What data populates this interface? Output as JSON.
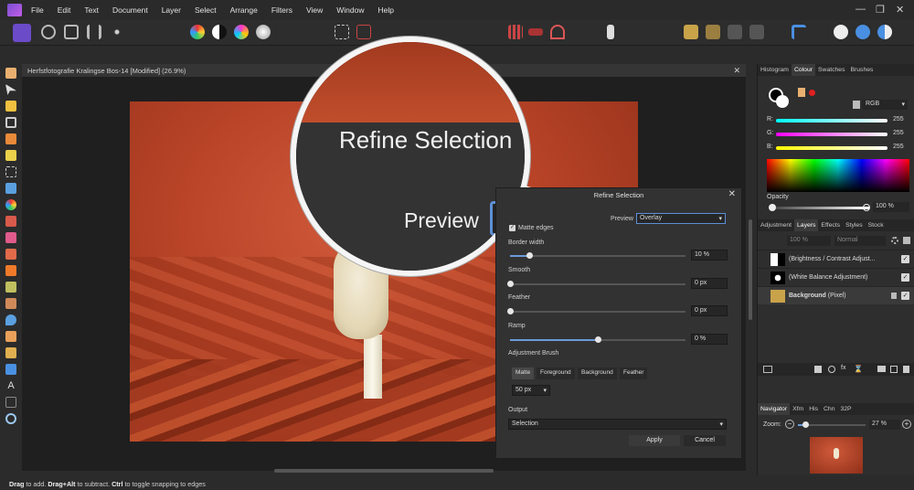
{
  "menubar": {
    "items": [
      "File",
      "Edit",
      "Text",
      "Document",
      "Layer",
      "Select",
      "Arrange",
      "Filters",
      "View",
      "Window",
      "Help"
    ]
  },
  "document": {
    "tab_title": "Herfstfotografie Kralingse Bos-14 [Modified] (26.9%)"
  },
  "magnifier": {
    "title": "Refine Selection",
    "preview_label": "Preview"
  },
  "dialog": {
    "title": "Refine Selection",
    "preview_label": "Preview",
    "preview_value": "Overlay",
    "matte_edges_label": "Matte edges",
    "matte_edges_checked": true,
    "sliders": [
      {
        "label": "Border width",
        "value": "10 %",
        "fraction": 0.11
      },
      {
        "label": "Smooth",
        "value": "0 px",
        "fraction": 0.0
      },
      {
        "label": "Feather",
        "value": "0 px",
        "fraction": 0.0
      },
      {
        "label": "Ramp",
        "value": "0 %",
        "fraction": 0.5
      }
    ],
    "adjustment_brush_label": "Adjustment Brush",
    "brush_modes": [
      "Matte",
      "Foreground",
      "Background",
      "Feather"
    ],
    "brush_mode_selected": "Matte",
    "brush_size": "50 px",
    "output_label": "Output",
    "output_value": "Selection",
    "apply_label": "Apply",
    "cancel_label": "Cancel"
  },
  "panels": {
    "top_tabs": [
      "Histogram",
      "Colour",
      "Swatches",
      "Brushes"
    ],
    "top_tab_active": "Colour",
    "colour_model": "RGB",
    "rgb": [
      {
        "label": "R:",
        "value": "255",
        "color": "#ff6b6b"
      },
      {
        "label": "G:",
        "value": "255",
        "color": "#8cff6b"
      },
      {
        "label": "B:",
        "value": "255",
        "color": "#6b8cff"
      }
    ],
    "opacity_label": "Opacity",
    "opacity_value": "100 %",
    "layer_tabs": [
      "Adjustment",
      "Layers",
      "Effects",
      "Styles",
      "Stock"
    ],
    "layer_tab_active": "Layers",
    "layer_opacity": "100 %",
    "blend_mode": "Normal",
    "layers": [
      {
        "name": "(Brightness / Contrast Adjust...",
        "bold": false
      },
      {
        "name": "(White Balance Adjustment)",
        "bold": false
      },
      {
        "name": "Background",
        "suffix": "(Pixel)",
        "bold": true
      }
    ],
    "nav_tabs": [
      "Navigator",
      "Xfm",
      "His",
      "Chn",
      "32P"
    ],
    "nav_tab_active": "Navigator",
    "zoom_label": "Zoom:",
    "zoom_value": "27 %"
  },
  "status": {
    "drag_label": "Drag",
    "to_add": " to add. ",
    "drag_alt_label": "Drag+Alt",
    "to_subtract": " to subtract. ",
    "ctrl_label": "Ctrl",
    "toggle_text": " to toggle snapping to edges"
  }
}
